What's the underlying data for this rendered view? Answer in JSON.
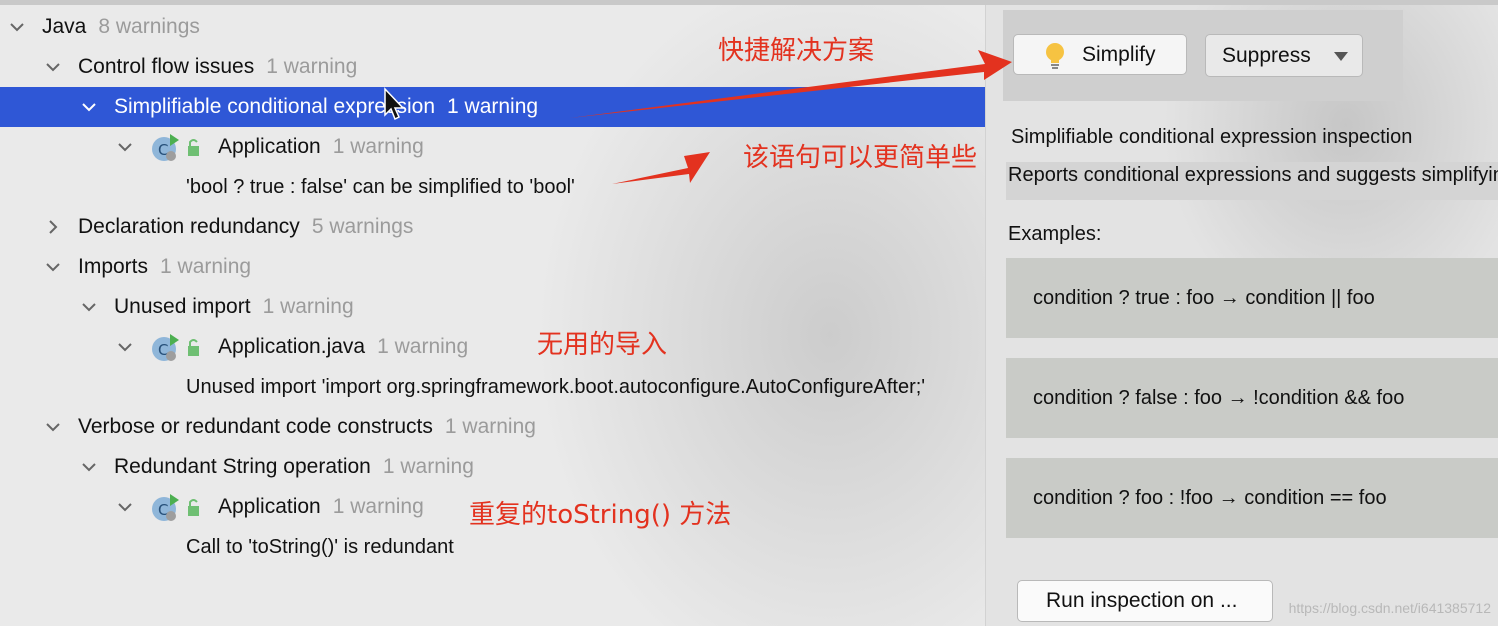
{
  "tree": {
    "rows": [
      {
        "label": "Java",
        "count": "8 warnings"
      },
      {
        "label": "Control flow issues",
        "count": "1 warning"
      },
      {
        "label": "Simplifiable conditional expression",
        "count": "1 warning"
      },
      {
        "label": "Application",
        "count": "1 warning"
      },
      {
        "label": "'bool ? true : false' can be simplified to 'bool'"
      },
      {
        "label": "Declaration redundancy",
        "count": "5 warnings"
      },
      {
        "label": "Imports",
        "count": "1 warning"
      },
      {
        "label": "Unused import",
        "count": "1 warning"
      },
      {
        "label": "Application.java",
        "count": "1 warning"
      },
      {
        "label": "Unused import 'import org.springframework.boot.autoconfigure.AutoConfigureAfter;'"
      },
      {
        "label": "Verbose or redundant code constructs",
        "count": "1 warning"
      },
      {
        "label": "Redundant String operation",
        "count": "1 warning"
      },
      {
        "label": "Application",
        "count": "1 warning"
      },
      {
        "label": "Call to 'toString()' is redundant"
      }
    ]
  },
  "right_panel": {
    "simplify_label": "Simplify",
    "suppress_label": "Suppress",
    "title": "Simplifiable conditional expression inspection",
    "description": "Reports conditional expressions and suggests simplifying them.",
    "examples_label": "Examples:",
    "examples": [
      "condition ? true : foo → condition || foo",
      "condition ? false : foo → !condition && foo",
      "condition ? foo : !foo → condition == foo"
    ],
    "run_label": "Run inspection on ...",
    "watermark": "https://blog.csdn.net/i641385712"
  },
  "annotations": {
    "quick_fix": "快捷解决方案",
    "simpler": "该语句可以更简单些",
    "unused_import": "无用的导入",
    "tostring": "重复的toString() 方法"
  },
  "colors": {
    "selection": "#2f57d6",
    "annotation": "#e3321f",
    "count_gray": "#9b9b9b"
  }
}
